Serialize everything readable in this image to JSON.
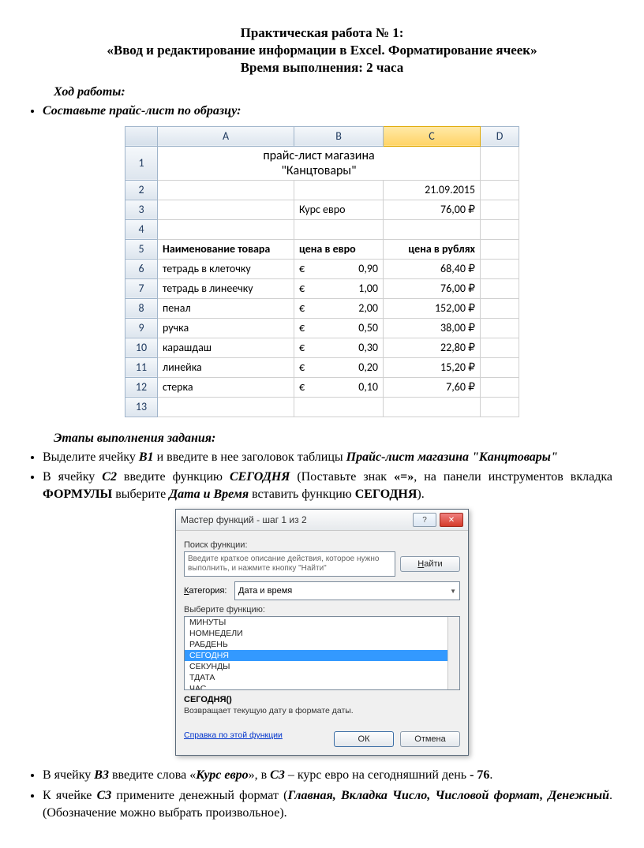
{
  "title_line1": "Практическая работа № 1:",
  "title_line2": "«Ввод и редактирование информации в Excel. Форматирование ячеек»",
  "title_line3": "Время выполнения: 2 часа",
  "sec1": "Ход работы:",
  "bullet1": "Составьте прайс-лист по образцу:",
  "excel": {
    "cols": {
      "A": "A",
      "B": "B",
      "C": "C",
      "D": "D"
    },
    "merged_title_l1": "прайс-лист магазина",
    "merged_title_l2": "\"Канцтовары\"",
    "date": "21.09.2015",
    "rate_label": "Курс евро",
    "rate_value": "76,00 ₽",
    "hdr_a": "Наименование товара",
    "hdr_b": "цена в евро",
    "hdr_c": "цена в рублях",
    "rows": [
      {
        "n": "6",
        "a": "тетрадь в клеточку",
        "b": "0,90",
        "c": "68,40 ₽"
      },
      {
        "n": "7",
        "a": "тетрадь в линеечку",
        "b": "1,00",
        "c": "76,00 ₽"
      },
      {
        "n": "8",
        "a": "пенал",
        "b": "2,00",
        "c": "152,00 ₽"
      },
      {
        "n": "9",
        "a": "ручка",
        "b": "0,50",
        "c": "38,00 ₽"
      },
      {
        "n": "10",
        "a": "карашдаш",
        "b": "0,30",
        "c": "22,80 ₽"
      },
      {
        "n": "11",
        "a": "линейка",
        "b": "0,20",
        "c": "15,20 ₽"
      },
      {
        "n": "12",
        "a": "стерка",
        "b": "0,10",
        "c": "7,60 ₽"
      }
    ],
    "euro_sym": "€"
  },
  "sec2": "Этапы выполнения задания:",
  "step2_p1": "Выделите ячейку ",
  "step2_b1": "В1",
  "step2_p2": " и введите в нее заголовок таблицы ",
  "step2_bi": "Прайс-лист магазина \"Канцтовары\"",
  "step3_p1": "В ячейку ",
  "step3_c2": "С2",
  "step3_p2": " введите функцию ",
  "step3_fn": "СЕГОДНЯ",
  "step3_p3": " (Поставьте знак ",
  "step3_eq": "«=»",
  "step3_p4": ", на панели инструментов вкладка ",
  "step3_form": "ФОРМУЛЫ",
  "step3_p5": " выберите ",
  "step3_dt": "Дата и Время",
  "step3_p6": " вставить функцию ",
  "step3_fn2": "СЕГОДНЯ",
  "step3_p7": ").",
  "dialog": {
    "title": "Мастер функций - шаг 1 из 2",
    "help_icon": "?",
    "close_icon": "✕",
    "search_label": "Поиск функции:",
    "search_text": "Введите краткое описание действия, которое нужно выполнить, и нажмите кнопку \"Найти\"",
    "find_btn": "Найти",
    "cat_label": "Категория:",
    "cat_value": "Дата и время",
    "select_label": "Выберите функцию:",
    "items": [
      "МИНУТЫ",
      "НОМНЕДЕЛИ",
      "РАБДЕНЬ",
      "СЕГОДНЯ",
      "СЕКУНДЫ",
      "ТДАТА",
      "ЧАС"
    ],
    "fn_sig": "СЕГОДНЯ()",
    "fn_desc": "Возвращает текущую дату в формате даты.",
    "help_link": "Справка по этой функции",
    "ok": "ОК",
    "cancel": "Отмена"
  },
  "step4_p1": "В ячейку ",
  "step4_b3": "В3",
  "step4_p2": " введите слова «",
  "step4_kr": "Курс евро",
  "step4_p3": "», в ",
  "step4_c3": "С3",
  "step4_p4": " – курс евро на сегодняшний день ",
  "step4_76": "- 76",
  "step4_dot": ".",
  "step5_p1": "К ячейке ",
  "step5_c3": "С3",
  "step5_p2": " примените денежный формат (",
  "step5_bi": "Главная, Вкладка Число, Числовой формат, Денежный",
  "step5_p3": ". (Обозначение можно выбрать произвольное)."
}
